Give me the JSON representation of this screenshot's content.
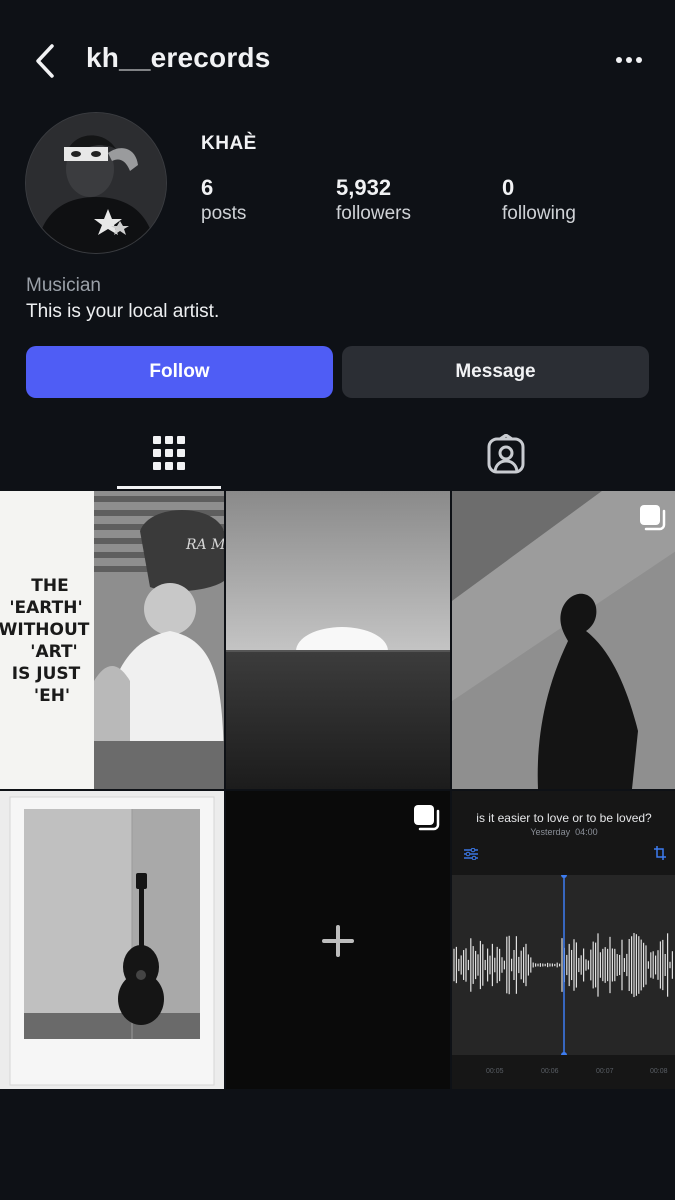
{
  "header": {
    "username": "kh__erecords",
    "back_icon": "chevron-left-icon",
    "more_icon": "more-horizontal-icon"
  },
  "profile": {
    "display_name": "KHAÈ",
    "stats": {
      "posts": {
        "value": "6",
        "label": "posts"
      },
      "followers": {
        "value": "5,932",
        "label": "followers"
      },
      "following": {
        "value": "0",
        "label": "following"
      }
    },
    "category": "Musician",
    "bio": "This is your local artist."
  },
  "actions": {
    "follow_label": "Follow",
    "message_label": "Message"
  },
  "tabs": [
    {
      "name": "posts-grid",
      "icon": "grid-icon",
      "active": true
    },
    {
      "name": "tagged",
      "icon": "tagged-person-icon",
      "active": false
    }
  ],
  "posts": [
    {
      "text_lines": [
        "THE",
        "'EARTH'",
        "WITHOUT",
        "'ART'",
        "IS JUST",
        "'EH'"
      ],
      "cap_text": "RA\nMN"
    },
    {},
    {
      "multi": true
    },
    {},
    {
      "multi": true,
      "icon": "plus-icon"
    },
    {
      "voice_memo_title": "is it easier to love or to be loved?",
      "voice_memo_date": "Yesterday",
      "voice_memo_duration": "04:00",
      "timeline": [
        "00:05",
        "00:06",
        "00:07",
        "00:08"
      ]
    }
  ],
  "colors": {
    "background": "#0e1116",
    "follow_button": "#4f5df5",
    "message_button": "#2b2e34",
    "voice_memo_accent": "#3d7cf0"
  }
}
